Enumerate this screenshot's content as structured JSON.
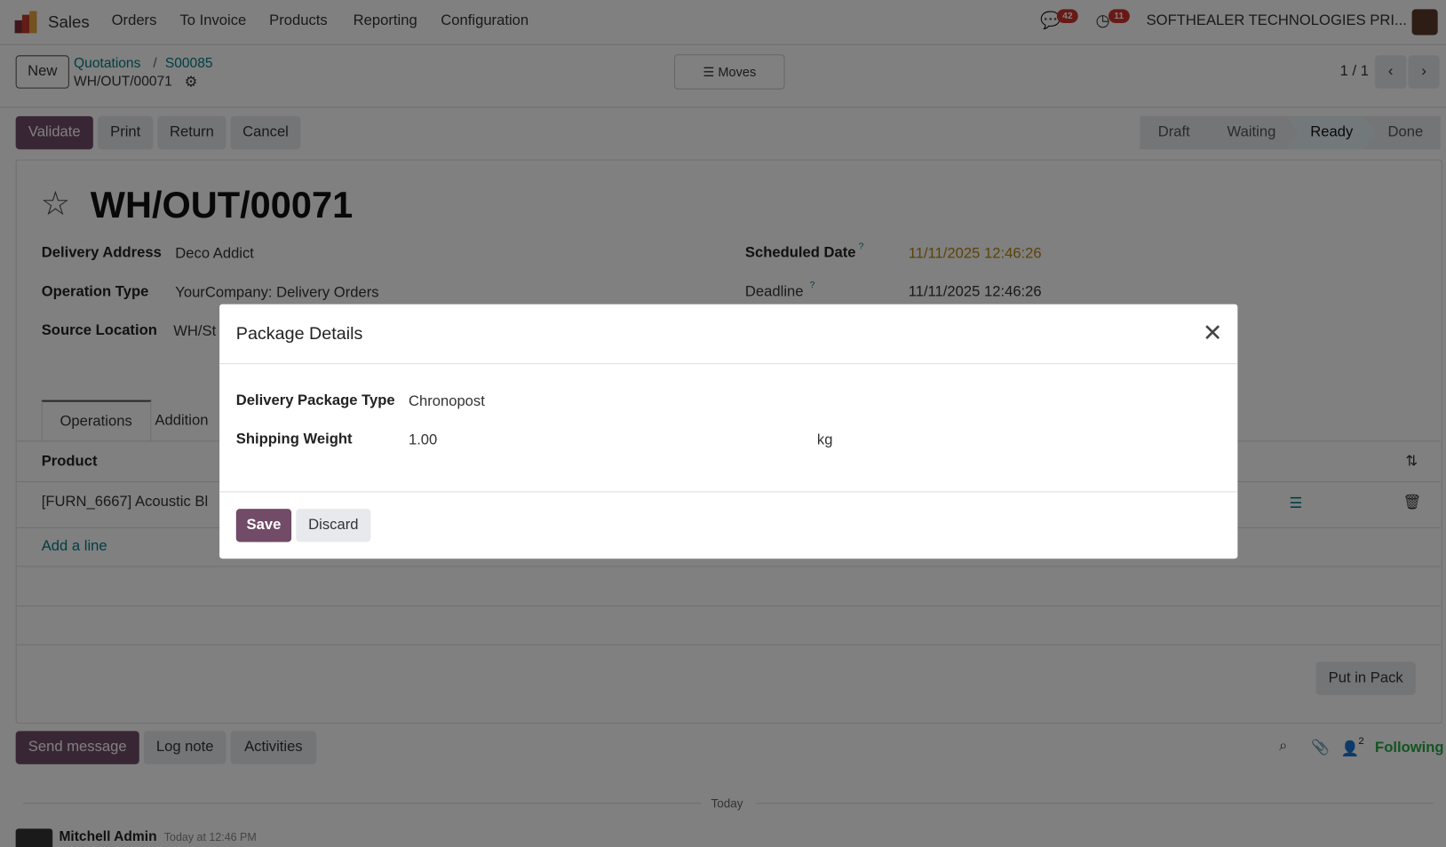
{
  "nav": {
    "app": "Sales",
    "menu": [
      "Orders",
      "To Invoice",
      "Products",
      "Reporting",
      "Configuration"
    ],
    "messages_count": "42",
    "activities_count": "11",
    "company": "SOFTHEALER TECHNOLOGIES PRI..."
  },
  "control": {
    "new_label": "New",
    "breadcrumb": [
      "Quotations",
      "S00085"
    ],
    "record": "WH/OUT/00071",
    "moves_label": "Moves",
    "pager": "1 / 1"
  },
  "actions": {
    "validate": "Validate",
    "print": "Print",
    "return": "Return",
    "cancel": "Cancel"
  },
  "statusbar": {
    "steps": [
      "Draft",
      "Waiting",
      "Ready",
      "Done"
    ],
    "active": "Ready"
  },
  "form": {
    "title": "WH/OUT/00071",
    "fields": {
      "delivery_address_label": "Delivery Address",
      "delivery_address": "Deco Addict",
      "operation_type_label": "Operation Type",
      "operation_type": "YourCompany: Delivery Orders",
      "source_location_label": "Source Location",
      "source_location": "WH/St",
      "scheduled_date_label": "Scheduled Date",
      "scheduled_date": "11/11/2025 12:46:26",
      "deadline_label": "Deadline",
      "deadline": "11/11/2025 12:46:26",
      "help": "?"
    },
    "tabs": [
      "Operations",
      "Addition"
    ],
    "table": {
      "col_product": "Product",
      "row": "[FURN_6667] Acoustic Bl",
      "add_line": "Add a line"
    },
    "put_in_pack": "Put in Pack"
  },
  "chatter": {
    "send_message": "Send message",
    "log_note": "Log note",
    "activities": "Activities",
    "followers_count": "2",
    "following": "Following",
    "today": "Today",
    "author": "Mitchell Admin",
    "time": "Today at 12:46 PM"
  },
  "modal": {
    "title": "Package Details",
    "package_type_label": "Delivery Package Type",
    "package_type": "Chronopost",
    "weight_label": "Shipping Weight",
    "weight": "1.00",
    "weight_unit": "kg",
    "save": "Save",
    "discard": "Discard"
  },
  "colors": {
    "primary": "#714b67",
    "link": "#017e84",
    "date_warning": "#b8860b",
    "following": "#28a745"
  }
}
